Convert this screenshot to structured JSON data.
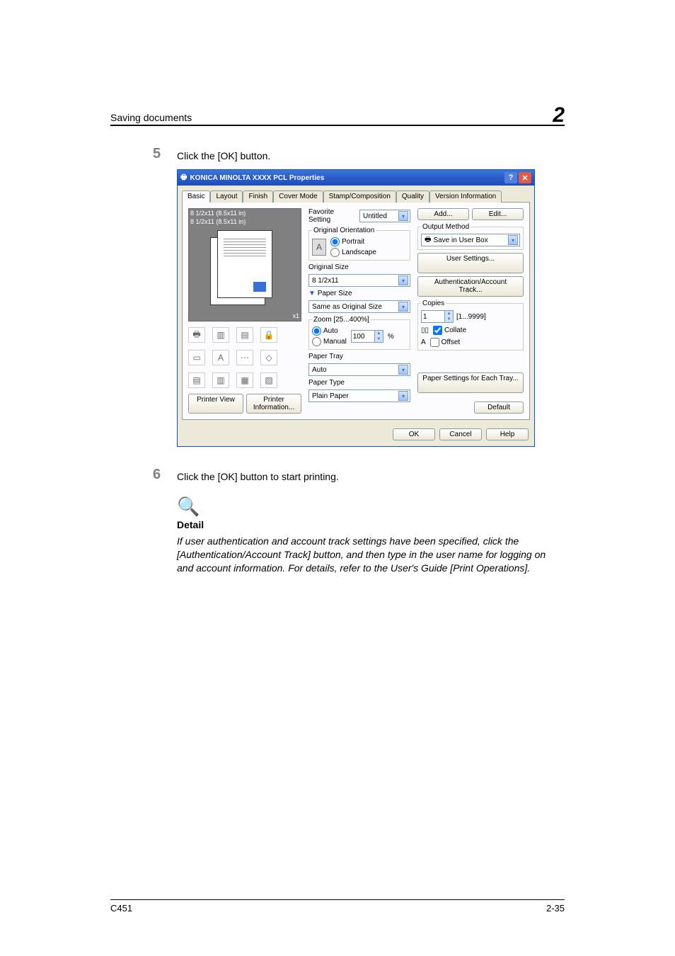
{
  "header": {
    "title": "Saving documents",
    "chapter": "2"
  },
  "steps": {
    "five": {
      "num": "5",
      "text": "Click the [OK] button."
    },
    "six": {
      "num": "6",
      "text": "Click the [OK] button to start printing."
    }
  },
  "dialog": {
    "title": "KONICA MINOLTA XXXX PCL Properties",
    "tabs": [
      "Basic",
      "Layout",
      "Finish",
      "Cover Mode",
      "Stamp/Composition",
      "Quality",
      "Version Information"
    ],
    "preview": {
      "label1": "8 1/2x11 (8.5x11 in)",
      "label2": "8 1/2x11 (8.5x11 in)",
      "x1": "x1"
    },
    "left_buttons": {
      "printer_view": "Printer View",
      "printer_info": "Printer Information..."
    },
    "favorite": {
      "label": "Favorite Setting",
      "value": "Untitled",
      "add": "Add...",
      "edit": "Edit..."
    },
    "orientation": {
      "legend": "Original Orientation",
      "portrait": "Portrait",
      "landscape": "Landscape"
    },
    "original_size": {
      "label": "Original Size",
      "value": "8 1/2x11"
    },
    "paper_size": {
      "label": "Paper Size",
      "value": "Same as Original Size"
    },
    "zoom": {
      "legend": "Zoom [25...400%]",
      "auto": "Auto",
      "manual": "Manual",
      "value": "100",
      "pct": "%"
    },
    "paper_tray": {
      "label": "Paper Tray",
      "value": "Auto"
    },
    "paper_type": {
      "label": "Paper Type",
      "value": "Plain Paper"
    },
    "output": {
      "legend": "Output Method",
      "value": "Save in User Box"
    },
    "user_settings": "User Settings...",
    "auth_track": "Authentication/Account Track...",
    "copies": {
      "legend": "Copies",
      "value": "1",
      "range": "[1...9999]",
      "collate": "Collate",
      "offset": "Offset"
    },
    "paper_settings_tray": "Paper Settings for Each Tray...",
    "default_btn": "Default",
    "bottom": {
      "ok": "OK",
      "cancel": "Cancel",
      "help": "Help"
    }
  },
  "detail": {
    "title": "Detail",
    "text": "If user authentication and account track settings have been specified, click the [Authentication/Account Track] button, and then type in the user name for logging on and account information. For details, refer to the User's Guide [Print Operations]."
  },
  "footer": {
    "left": "C451",
    "right": "2-35"
  }
}
